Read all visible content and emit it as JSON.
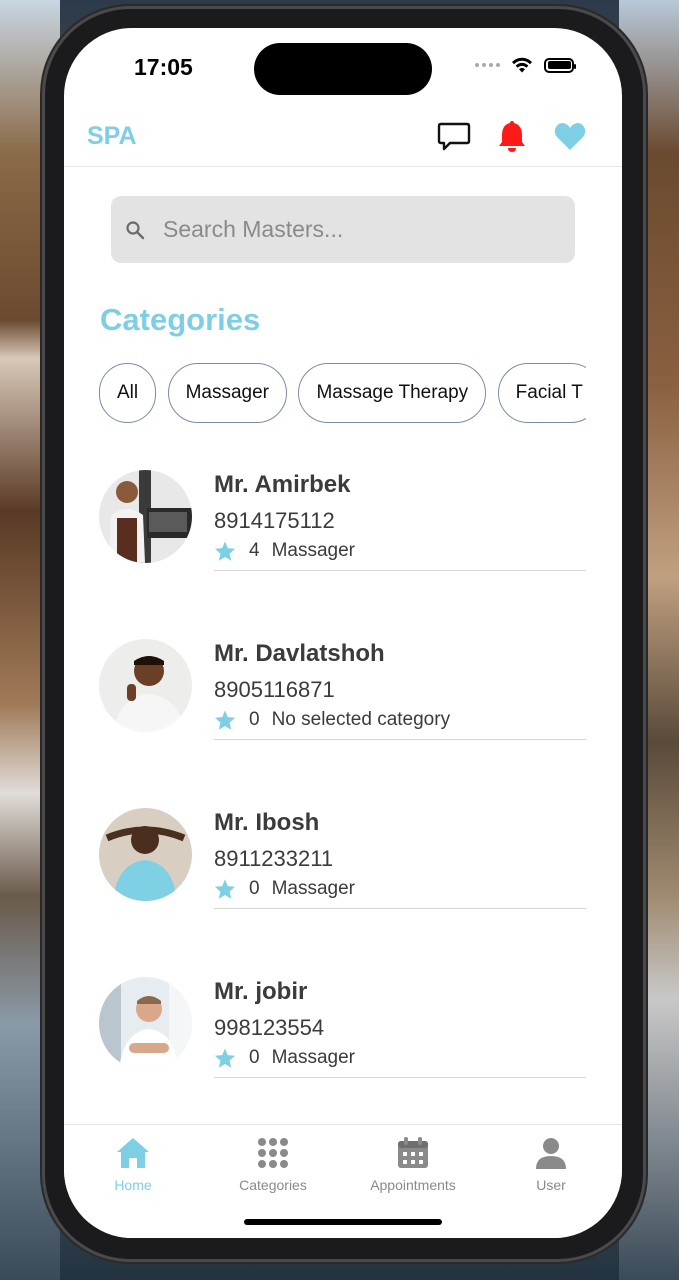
{
  "status_bar": {
    "time": "17:05"
  },
  "header": {
    "brand": "SPA",
    "icons": [
      "chat-icon",
      "bell-icon",
      "heart-icon"
    ]
  },
  "search": {
    "placeholder": "Search Masters..."
  },
  "categories": {
    "title": "Categories",
    "chips": [
      "All",
      "Massager",
      "Massage Therapy",
      "Facial T"
    ]
  },
  "masters": [
    {
      "name": "Mr. Amirbek",
      "phone": "8914175112",
      "rating": "4",
      "category": "Massager"
    },
    {
      "name": "Mr. Davlatshoh",
      "phone": "8905116871",
      "rating": "0",
      "category": "No selected category"
    },
    {
      "name": "Mr. Ibosh",
      "phone": "8911233211",
      "rating": "0",
      "category": "Massager"
    },
    {
      "name": "Mr. jobir",
      "phone": "998123554",
      "rating": "0",
      "category": "Massager"
    }
  ],
  "tabbar": {
    "tabs": [
      {
        "label": "Home",
        "icon": "home-icon",
        "active": true
      },
      {
        "label": "Categories",
        "icon": "grid-icon",
        "active": false
      },
      {
        "label": "Appointments",
        "icon": "calendar-icon",
        "active": false
      },
      {
        "label": "User",
        "icon": "user-icon",
        "active": false
      }
    ]
  },
  "colors": {
    "accent": "#7fcfe4",
    "bell": "#ff1a1a",
    "text": "#3b3b3b",
    "chip_border": "#7d8aa6"
  }
}
